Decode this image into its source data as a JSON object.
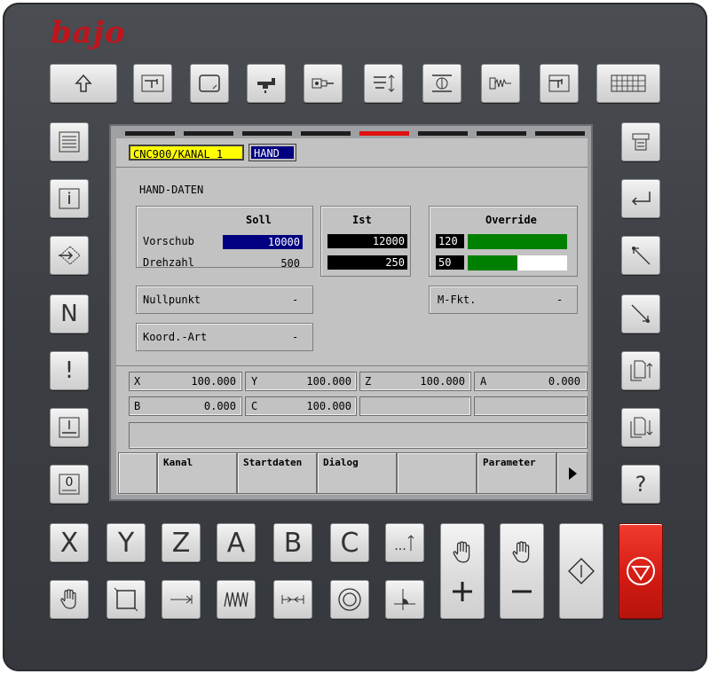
{
  "brand": {
    "logo_text": "bajo",
    "accent_color": "#c0141b"
  },
  "screen": {
    "channel_label": "CNC900/KANAL 1",
    "mode_label": "HAND",
    "section_title": "HAND-DATEN",
    "soll": {
      "header": "Soll",
      "vorschub_label": "Vorschub",
      "vorschub_value": "10000",
      "drehzahl_label": "Drehzahl",
      "drehzahl_value": "500"
    },
    "ist": {
      "header": "Ist",
      "value1": "12000",
      "value2": "250"
    },
    "override": {
      "header": "Override",
      "feed_value": "120",
      "feed_fill": 1.0,
      "spindle_value": "50",
      "spindle_fill": 0.5
    },
    "nullpunkt": {
      "label": "Nullpunkt",
      "value": "-"
    },
    "koord": {
      "label": "Koord.-Art",
      "value": "-"
    },
    "mfkt": {
      "label": "M-Fkt.",
      "value": "-"
    },
    "axes": [
      {
        "name": "X",
        "value": "100.000"
      },
      {
        "name": "Y",
        "value": "100.000"
      },
      {
        "name": "Z",
        "value": "100.000"
      },
      {
        "name": "A",
        "value": "0.000"
      },
      {
        "name": "B",
        "value": "0.000"
      },
      {
        "name": "C",
        "value": "100.000"
      }
    ],
    "softkeys": [
      "",
      "Kanal",
      "Startdaten",
      "Dialog",
      "",
      "Parameter"
    ],
    "colors": {
      "channel_bg": "#ffff00",
      "mode_bg": "#000080",
      "field_blue": "#000080",
      "bar_green": "#008000"
    }
  },
  "keys": {
    "letters": [
      "X",
      "Y",
      "Z",
      "A",
      "B",
      "C"
    ],
    "dots_label": "...",
    "side_n": "N",
    "side_excl": "!",
    "side_zero": "0",
    "side_info": "i",
    "side_question": "?"
  }
}
